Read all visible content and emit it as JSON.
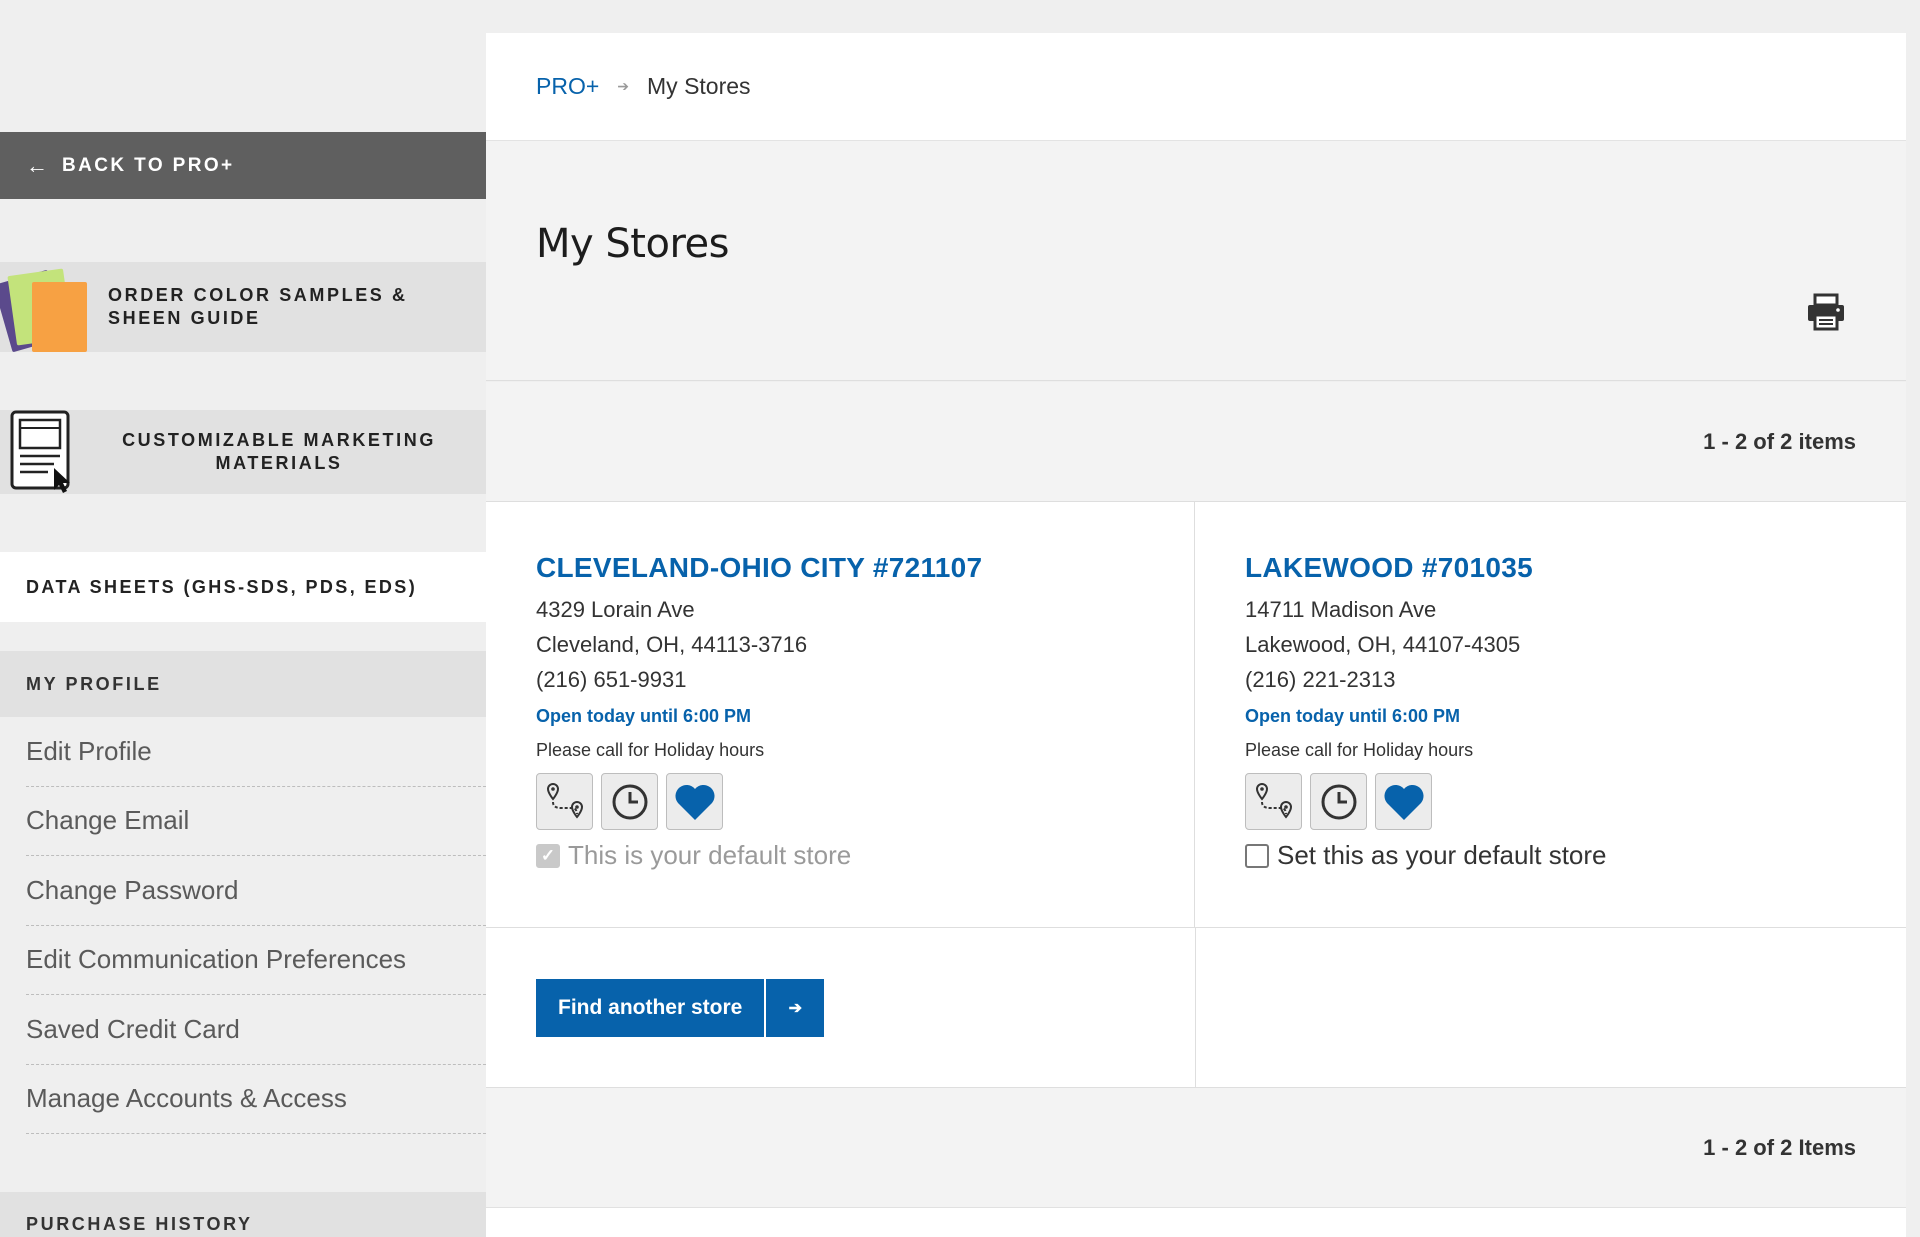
{
  "sidebar": {
    "back_label": "BACK TO PRO+",
    "promo_samples": "ORDER COLOR SAMPLES & SHEEN GUIDE",
    "promo_marketing": "CUSTOMIZABLE MARKETING MATERIALS",
    "data_sheets": "DATA SHEETS (GHS-SDS, PDS, EDS)",
    "profile_heading": "MY PROFILE",
    "profile_links": [
      "Edit Profile",
      "Change Email",
      "Change Password",
      "Edit Communication Preferences",
      "Saved Credit Card",
      "Manage Accounts & Access"
    ],
    "history_heading": "PURCHASE HISTORY"
  },
  "breadcrumb": {
    "root": "PRO+",
    "current": "My Stores"
  },
  "page": {
    "title": "My Stores",
    "count_top": "1 - 2 of 2 items",
    "count_bottom": "1 - 2 of 2 Items",
    "find_button": "Find another store"
  },
  "stores": [
    {
      "name": "CLEVELAND-OHIO CITY #721107",
      "street": "4329 Lorain Ave",
      "city": "Cleveland, OH, 44113-3716",
      "phone": "(216) 651-9931",
      "hours": "Open today until 6:00 PM",
      "note": "Please call for Holiday hours",
      "default_label": "This is your default store",
      "is_default": true
    },
    {
      "name": "LAKEWOOD #701035",
      "street": "14711 Madison Ave",
      "city": "Lakewood, OH, 44107-4305",
      "phone": "(216) 221-2313",
      "hours": "Open today until 6:00 PM",
      "note": "Please call for Holiday hours",
      "default_label": "Set this as your default store",
      "is_default": false
    }
  ],
  "colors": {
    "brand_blue": "#0762ab",
    "sidebar_dark": "#5f5f5f"
  },
  "icons": [
    "left-arrow-icon",
    "tablet-cursor-icon",
    "print-icon",
    "directions-icon",
    "clock-icon",
    "heart-icon",
    "checkmark-icon",
    "right-arrow-icon"
  ]
}
